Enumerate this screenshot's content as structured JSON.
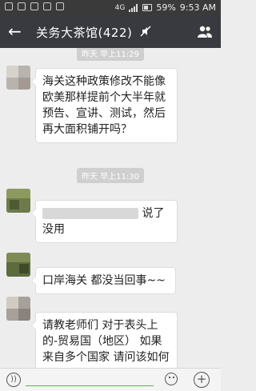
{
  "statusbar": {
    "battery": "59%",
    "time": "9:53 AM",
    "network": "4G"
  },
  "titlebar": {
    "back_icon": "back-arrow-icon",
    "title": "关务大茶馆(422)",
    "mute_icon": "mute-icon",
    "menu_icon": "group-members-icon"
  },
  "messages": [
    {
      "type": "time",
      "text": "昨天 早上11:29"
    },
    {
      "type": "text",
      "text": "海关这种政策修改不能像欧美那样提前个大半年就预告、宣讲、测试，然后再大面积铺开吗？"
    },
    {
      "type": "time",
      "text": "昨天 早上11:30"
    },
    {
      "type": "text",
      "text": "说了没用",
      "redacted_prefix": true
    },
    {
      "type": "text",
      "text": "口岸海关 都没当回事~~"
    },
    {
      "type": "text",
      "text": "请教老师们 对于表头上的-贸易国（地区） 如果来自多个国家 请问该如何"
    }
  ],
  "colors": {
    "titlebar": "#393a3f",
    "background": "#ededed",
    "input_underline": "#58b54a"
  }
}
